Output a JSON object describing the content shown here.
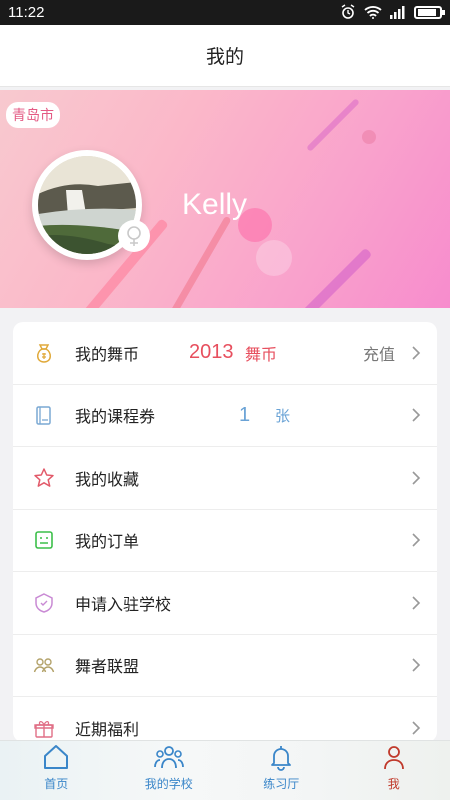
{
  "status_bar": {
    "time": "11:22"
  },
  "header": {
    "title": "我的"
  },
  "profile": {
    "city": "青岛市",
    "username": "Kelly",
    "avatar": "waterfall-landscape-photo",
    "gender_icon": "female-icon"
  },
  "menu": {
    "coins": {
      "label": "我的舞币",
      "value": "2013",
      "unit": "舞币",
      "action": "充值",
      "icon": "money-bag-icon"
    },
    "voucher": {
      "label": "我的课程券",
      "value": "1",
      "unit": "张",
      "icon": "voucher-icon"
    },
    "favorites": {
      "label": "我的收藏",
      "icon": "star-icon"
    },
    "orders": {
      "label": "我的订单",
      "icon": "order-icon"
    },
    "apply_school": {
      "label": "申请入驻学校",
      "icon": "shield-icon"
    },
    "alliance": {
      "label": "舞者联盟",
      "icon": "people-icon"
    },
    "benefits": {
      "label": "近期福利",
      "icon": "gift-icon"
    }
  },
  "tabs": [
    {
      "label": "首页",
      "icon": "home-icon"
    },
    {
      "label": "我的学校",
      "icon": "group-icon"
    },
    {
      "label": "练习厅",
      "icon": "bell-icon"
    },
    {
      "label": "我",
      "icon": "user-icon"
    }
  ],
  "colors": {
    "accent_red": "#e74f5e",
    "accent_blue": "#3a86c9",
    "banner_pink": "#f9a2cc"
  }
}
